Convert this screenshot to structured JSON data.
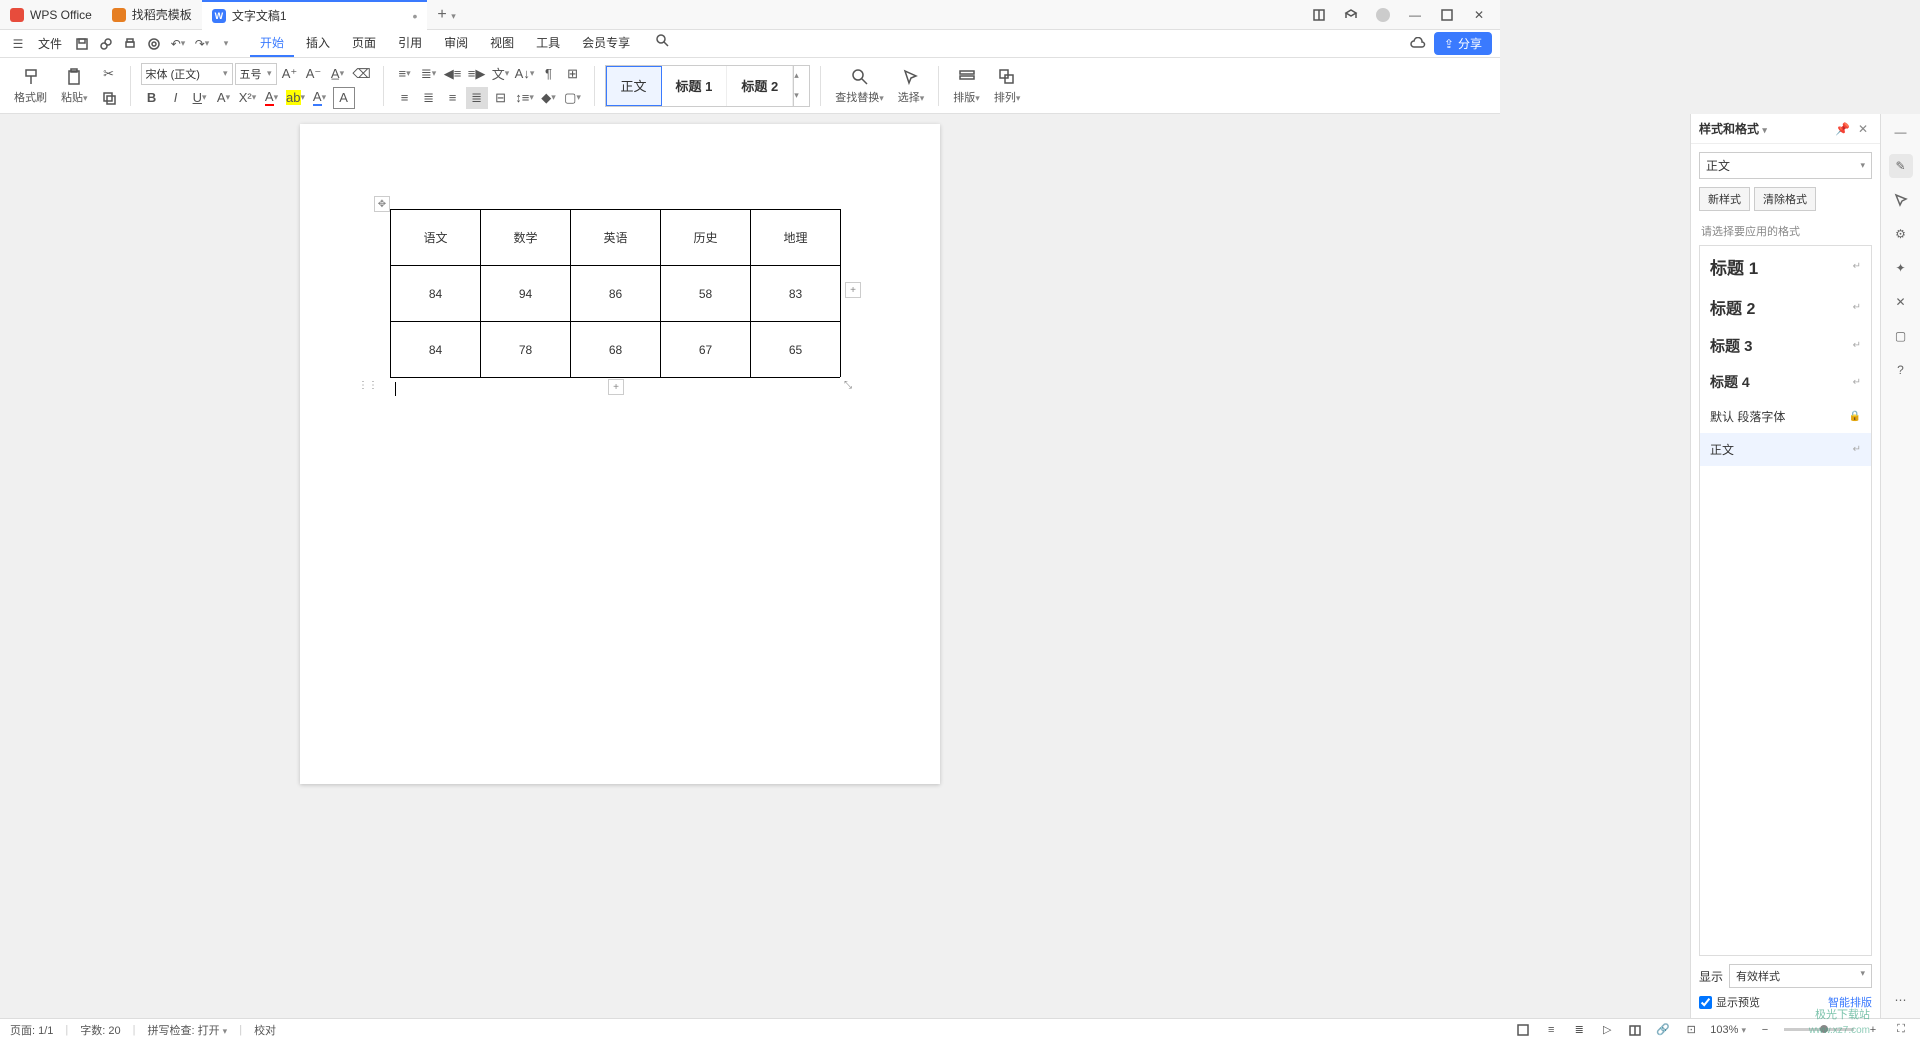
{
  "tabs": [
    {
      "label": "WPS Office"
    },
    {
      "label": "找稻壳模板"
    },
    {
      "label": "文字文稿1"
    }
  ],
  "menu": {
    "file": "文件",
    "items": [
      "开始",
      "插入",
      "页面",
      "引用",
      "审阅",
      "视图",
      "工具",
      "会员专享"
    ]
  },
  "share": "分享",
  "ribbon": {
    "format_painter": "格式刷",
    "paste": "粘贴",
    "font": "宋体 (正文)",
    "size": "五号",
    "styles": [
      "正文",
      "标题 1",
      "标题 2"
    ],
    "find_replace": "查找替换",
    "select": "选择",
    "layout": "排版",
    "arrange": "排列"
  },
  "table": {
    "headers": [
      "语文",
      "数学",
      "英语",
      "历史",
      "地理"
    ],
    "rows": [
      [
        "84",
        "94",
        "86",
        "58",
        "83"
      ],
      [
        "84",
        "78",
        "68",
        "67",
        "65"
      ]
    ]
  },
  "side_panel": {
    "title": "样式和格式",
    "current": "正文",
    "new_style": "新样式",
    "clear_format": "清除格式",
    "hint": "请选择要应用的格式",
    "items": [
      {
        "label": "标题 1",
        "cls": "h1"
      },
      {
        "label": "标题 2",
        "cls": "h2"
      },
      {
        "label": "标题 3",
        "cls": "h3"
      },
      {
        "label": "标题 4",
        "cls": "h4"
      },
      {
        "label": "默认 段落字体",
        "cls": "def",
        "locked": true
      },
      {
        "label": "正文",
        "cls": "normal",
        "sel": true
      }
    ],
    "show_label": "显示",
    "show_value": "有效样式",
    "preview": "显示预览",
    "smart": "智能排版"
  },
  "status": {
    "page": "页面: 1/1",
    "words": "字数: 20",
    "spell": "拼写检查: 打开",
    "proof": "校对",
    "zoom": "103%"
  },
  "watermark": {
    "l1": "极光下载站",
    "l2": "www.xz7.com"
  }
}
